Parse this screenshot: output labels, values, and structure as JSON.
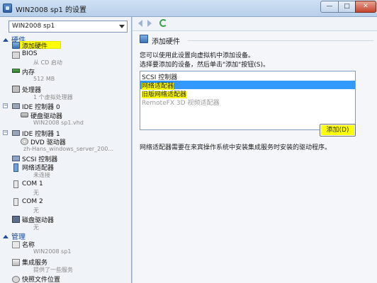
{
  "window": {
    "title": "WIN2008 sp1 的设置",
    "minimize_label": "—",
    "maximize_label": "□",
    "close_label": "✕"
  },
  "sidebar": {
    "vm_selected": "WIN2008 sp1",
    "sections": {
      "hardware": "硬件",
      "management": "管理"
    },
    "items": {
      "add_hardware": "添加硬件",
      "bios": "BIOS",
      "bios_sub": "从 CD 启动",
      "memory": "内存",
      "memory_sub": "512 MB",
      "processor": "处理器",
      "processor_sub": "1 个虚拟处理器",
      "ide0": "IDE 控制器 0",
      "hdd": "硬盘驱动器",
      "hdd_sub": "WIN2008 sp1.vhd",
      "ide1": "IDE 控制器 1",
      "dvd": "DVD 驱动器",
      "dvd_sub": "zh-Hans_windows_server_200...",
      "scsi": "SCSI 控制器",
      "netadapter": "网络适配器",
      "netadapter_sub": "未连接",
      "com1": "COM 1",
      "com1_sub": "无",
      "com2": "COM 2",
      "com2_sub": "无",
      "floppy": "磁盘驱动器",
      "floppy_sub": "无",
      "name": "名称",
      "name_sub": "WIN2008 sp1",
      "integration": "集成服务",
      "integration_sub": "提供了一些服务",
      "snapshot": "快照文件位置"
    }
  },
  "main": {
    "group_title": "添加硬件",
    "desc_line1": "您可以使用此设置向虚拟机中添加设备。",
    "desc_line2": "选择要添加的设备，然后单击\"添加\"按钮(S)。",
    "device_list": [
      "SCSI 控制器",
      "网络适配器",
      "旧版网络适配器",
      "RemoteFX 3D 视频适配器"
    ],
    "add_button": "添加(D)",
    "note": "网络适配器需要在来宾操作系统中安装集成服务时安装的驱动程序。"
  },
  "colors": {
    "highlight": "#ffff00",
    "selection": "#3399ff",
    "section": "#1e4d9a"
  }
}
